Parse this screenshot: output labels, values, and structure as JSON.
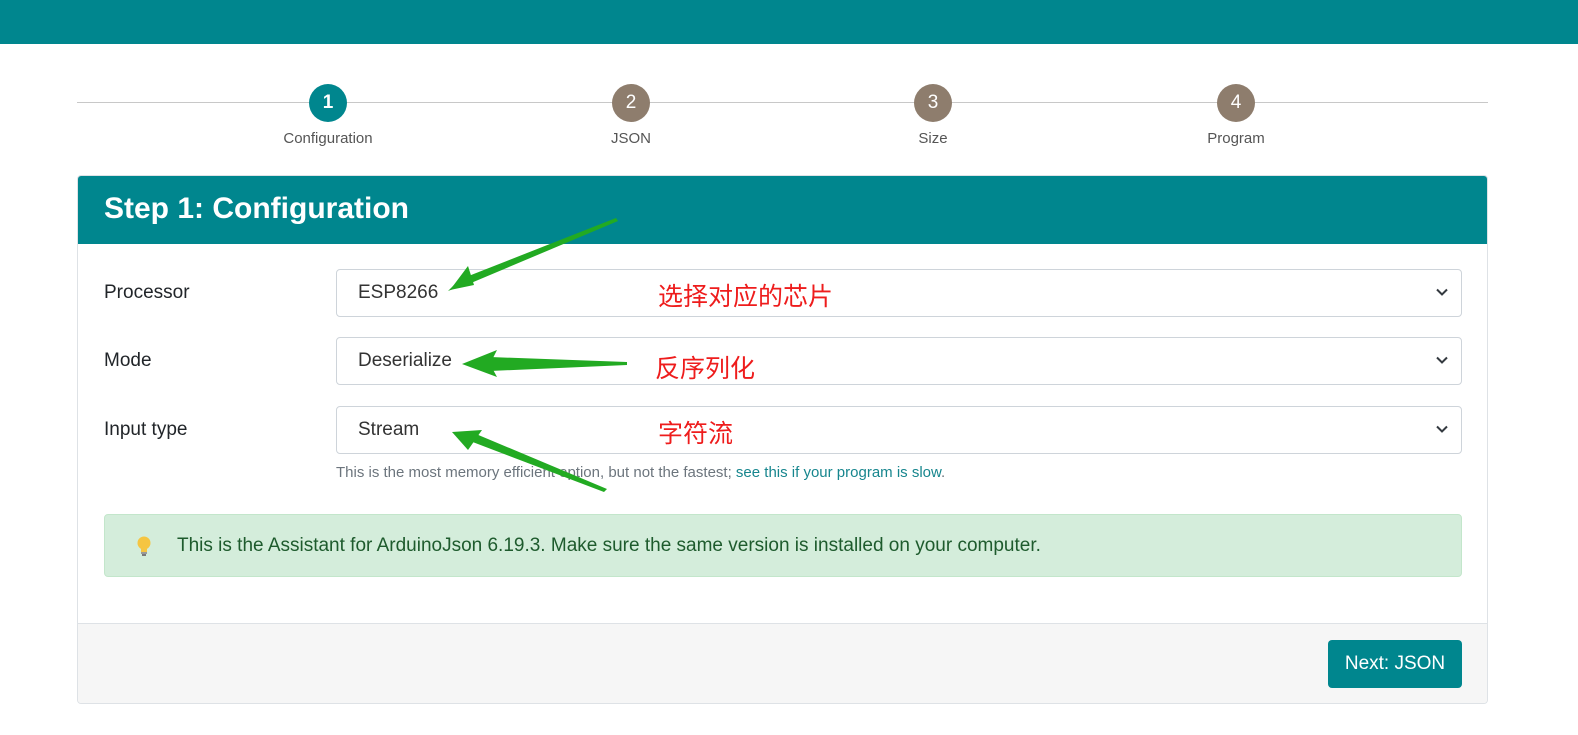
{
  "stepper": {
    "steps": [
      {
        "number": "1",
        "label": "Configuration",
        "active": true
      },
      {
        "number": "2",
        "label": "JSON",
        "active": false
      },
      {
        "number": "3",
        "label": "Size",
        "active": false
      },
      {
        "number": "4",
        "label": "Program",
        "active": false
      }
    ]
  },
  "card": {
    "title": "Step 1: Configuration",
    "fields": [
      {
        "label": "Processor",
        "value": "ESP8266"
      },
      {
        "label": "Mode",
        "value": "Deserialize"
      },
      {
        "label": "Input type",
        "value": "Stream"
      }
    ],
    "help_text": "This is the most memory efficient option, but not the fastest; ",
    "help_link": "see this if your program is slow",
    "help_suffix": ".",
    "alert_text": "This is the Assistant for ArduinoJson 6.19.3. Make sure the same version is installed on your computer.",
    "next_button": "Next: JSON"
  },
  "annotations": {
    "processor_note": "选择对应的芯片",
    "mode_note": "反序列化",
    "input_type_note": "字符流"
  },
  "colors": {
    "brand": "#00868e",
    "step_inactive": "#8e7d6d",
    "annotation_text": "#ee1c1c",
    "annotation_arrow": "#22aa22",
    "alert_bg": "#d4eddb"
  },
  "icons": {
    "select_chevron": "chevron-down-icon",
    "alert": "lightbulb-icon"
  }
}
